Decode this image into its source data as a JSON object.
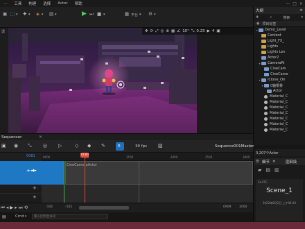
{
  "menu": {
    "items": [
      "...",
      "工具",
      "构建",
      "选择",
      "Actor",
      "帮助"
    ],
    "window_controls": [
      "—",
      "□",
      "×"
    ]
  },
  "toolbar": {
    "platform_label": "平台",
    "platform_chevron": "▾",
    "mode_chevron": "▾"
  },
  "viewport": {
    "left_tab": "透",
    "snap_angle": "10°",
    "snap_scale": "0.25",
    "cam_speed": "4"
  },
  "outliner": {
    "title": "大纲",
    "close": "×",
    "search_placeholder": "搜索",
    "column_label": "项目标签",
    "rows": [
      {
        "label": "Demo_Level",
        "type": "level",
        "twist": "▾",
        "indent": 0
      },
      {
        "label": "Content",
        "type": "folder",
        "twist": "",
        "indent": 1
      },
      {
        "label": "Light_FX_",
        "type": "folder",
        "twist": "",
        "indent": 1
      },
      {
        "label": "Lights",
        "type": "folder",
        "twist": "",
        "indent": 1
      },
      {
        "label": "Lights Lev",
        "type": "folder",
        "twist": "",
        "indent": 1
      },
      {
        "label": "Actor2",
        "type": "actor",
        "twist": "",
        "indent": 1
      },
      {
        "label": "CameraRi",
        "type": "actor",
        "twist": "▾",
        "indent": 1
      },
      {
        "label": "CineCam",
        "type": "actor",
        "twist": "",
        "indent": 2
      },
      {
        "label": "CineCame",
        "type": "actor",
        "twist": "",
        "indent": 2
      },
      {
        "label": "iClone_Ori",
        "type": "actor",
        "twist": "▾",
        "indent": 1
      },
      {
        "label": "0轴根骨",
        "type": "actor",
        "twist": "▾",
        "indent": 2
      },
      {
        "label": "Actor",
        "type": "actor",
        "twist": "",
        "indent": 3
      },
      {
        "label": "Material_C",
        "type": "mat",
        "twist": "",
        "indent": 2
      },
      {
        "label": "Material_C",
        "type": "mat",
        "twist": "",
        "indent": 2
      },
      {
        "label": "Material_C",
        "type": "mat",
        "twist": "",
        "indent": 2
      },
      {
        "label": "Material_C",
        "type": "mat",
        "twist": "",
        "indent": 2
      },
      {
        "label": "Material_C",
        "type": "mat",
        "twist": "",
        "indent": 2
      },
      {
        "label": "Material_C",
        "type": "mat",
        "twist": "",
        "indent": 2
      },
      {
        "label": "Material_C",
        "type": "mat",
        "twist": "",
        "indent": 2
      }
    ],
    "footer": "3,207个Actor"
  },
  "details": {
    "tab_details": "细节",
    "tab_close": "×",
    "tab_render": "渲染设",
    "slate_label": "SLATE",
    "scene_name": "Scene_1",
    "date_text": "2022年8月2日 上午06:20"
  },
  "sequencer": {
    "tab_title": "Sequencer",
    "tab_close": "×",
    "fps": "30 fps",
    "sequence_name": "Sequence001Master",
    "frame_field": "0081",
    "playhead_label": "0081",
    "ruler_ticks": [
      "0000",
      "1000",
      "1500",
      "2000",
      "2500",
      "3000",
      "3500"
    ],
    "clip_label": "CineCameraActor",
    "range_start": "-102",
    "range_start2": "-102",
    "range_end": "0909",
    "range_end2": "3000"
  },
  "status": {
    "cmd_label": "Cmd",
    "console_placeholder": "输入控制台命令",
    "chevron": "▾"
  },
  "colors": {
    "accent_blue": "#1f6fbd",
    "playhead": "#e04b3a",
    "track_blue": "#1f78c4"
  }
}
